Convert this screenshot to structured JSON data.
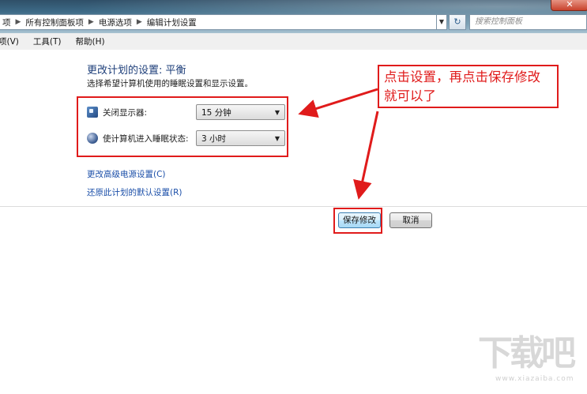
{
  "window": {
    "close_label": "✕",
    "breadcrumb": [
      "项",
      "所有控制面板项",
      "电源选项",
      "编辑计划设置"
    ],
    "search_placeholder": "搜索控制面板",
    "refresh_label": "↻",
    "menu": [
      "项(V)",
      "工具(T)",
      "帮助(H)"
    ]
  },
  "page": {
    "title": "更改计划的设置: 平衡",
    "subtitle": "选择希望计算机使用的睡眠设置和显示设置。",
    "settings": [
      {
        "icon": "monitor-icon",
        "label": "关闭显示器:",
        "value": "15 分钟"
      },
      {
        "icon": "moon-icon",
        "label": "使计算机进入睡眠状态:",
        "value": "3 小时"
      }
    ],
    "links": {
      "advanced": "更改高级电源设置(C)",
      "restore": "还原此计划的默认设置(R)"
    },
    "buttons": {
      "save": "保存修改",
      "cancel": "取消"
    }
  },
  "annotation": {
    "text": "点击设置，再点击保存修改就可以了",
    "color": "#e01b1b"
  },
  "watermark": {
    "text": "下载吧",
    "subtext": "www.xiazaiba.com"
  }
}
